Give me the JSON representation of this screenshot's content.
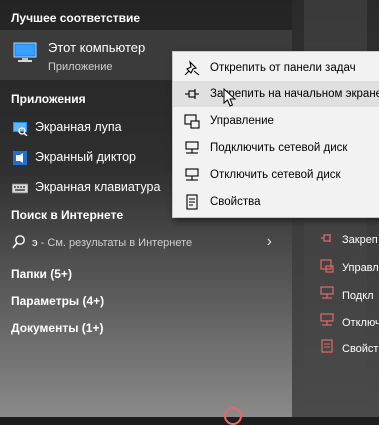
{
  "best_match": {
    "header": "Лучшее соответствие",
    "title": "Этот компьютер",
    "subtitle": "Приложение"
  },
  "apps": {
    "header": "Приложения",
    "items": [
      {
        "label": "Экранная лупа",
        "icon": "magnifier-icon"
      },
      {
        "label": "Экранный диктор",
        "icon": "narrator-icon"
      },
      {
        "label": "Экранная клавиатура",
        "icon": "keyboard-icon"
      }
    ]
  },
  "web": {
    "header": "Поиск в Интернете",
    "query": "э",
    "suffix": " - См. результаты в Интернете"
  },
  "categories": {
    "folders": "Папки (5+)",
    "settings": "Параметры (4+)",
    "documents": "Документы (1+)"
  },
  "context_menu": {
    "items": [
      {
        "label": "Открепить от панели задач",
        "icon": "unpin-icon"
      },
      {
        "label": "Закрепить на начальном экране",
        "icon": "pin-icon"
      },
      {
        "label": "Управление",
        "icon": "manage-icon"
      },
      {
        "label": "Подключить сетевой диск",
        "icon": "map-drive-icon"
      },
      {
        "label": "Отключить сетевой диск",
        "icon": "disconnect-drive-icon"
      },
      {
        "label": "Свойства",
        "icon": "properties-icon"
      }
    ],
    "hovered_index": 1
  },
  "preview_actions": {
    "items": [
      {
        "label": "Закреп"
      },
      {
        "label": "Управл"
      },
      {
        "label": "Подкл"
      },
      {
        "label": "Отключ"
      },
      {
        "label": "Свойст"
      }
    ]
  },
  "colors": {
    "accent": "#0078d7",
    "preview_icon": "#e06a6a",
    "menu_bg": "#f2f2f2",
    "menu_hover": "#e0e0e0"
  }
}
